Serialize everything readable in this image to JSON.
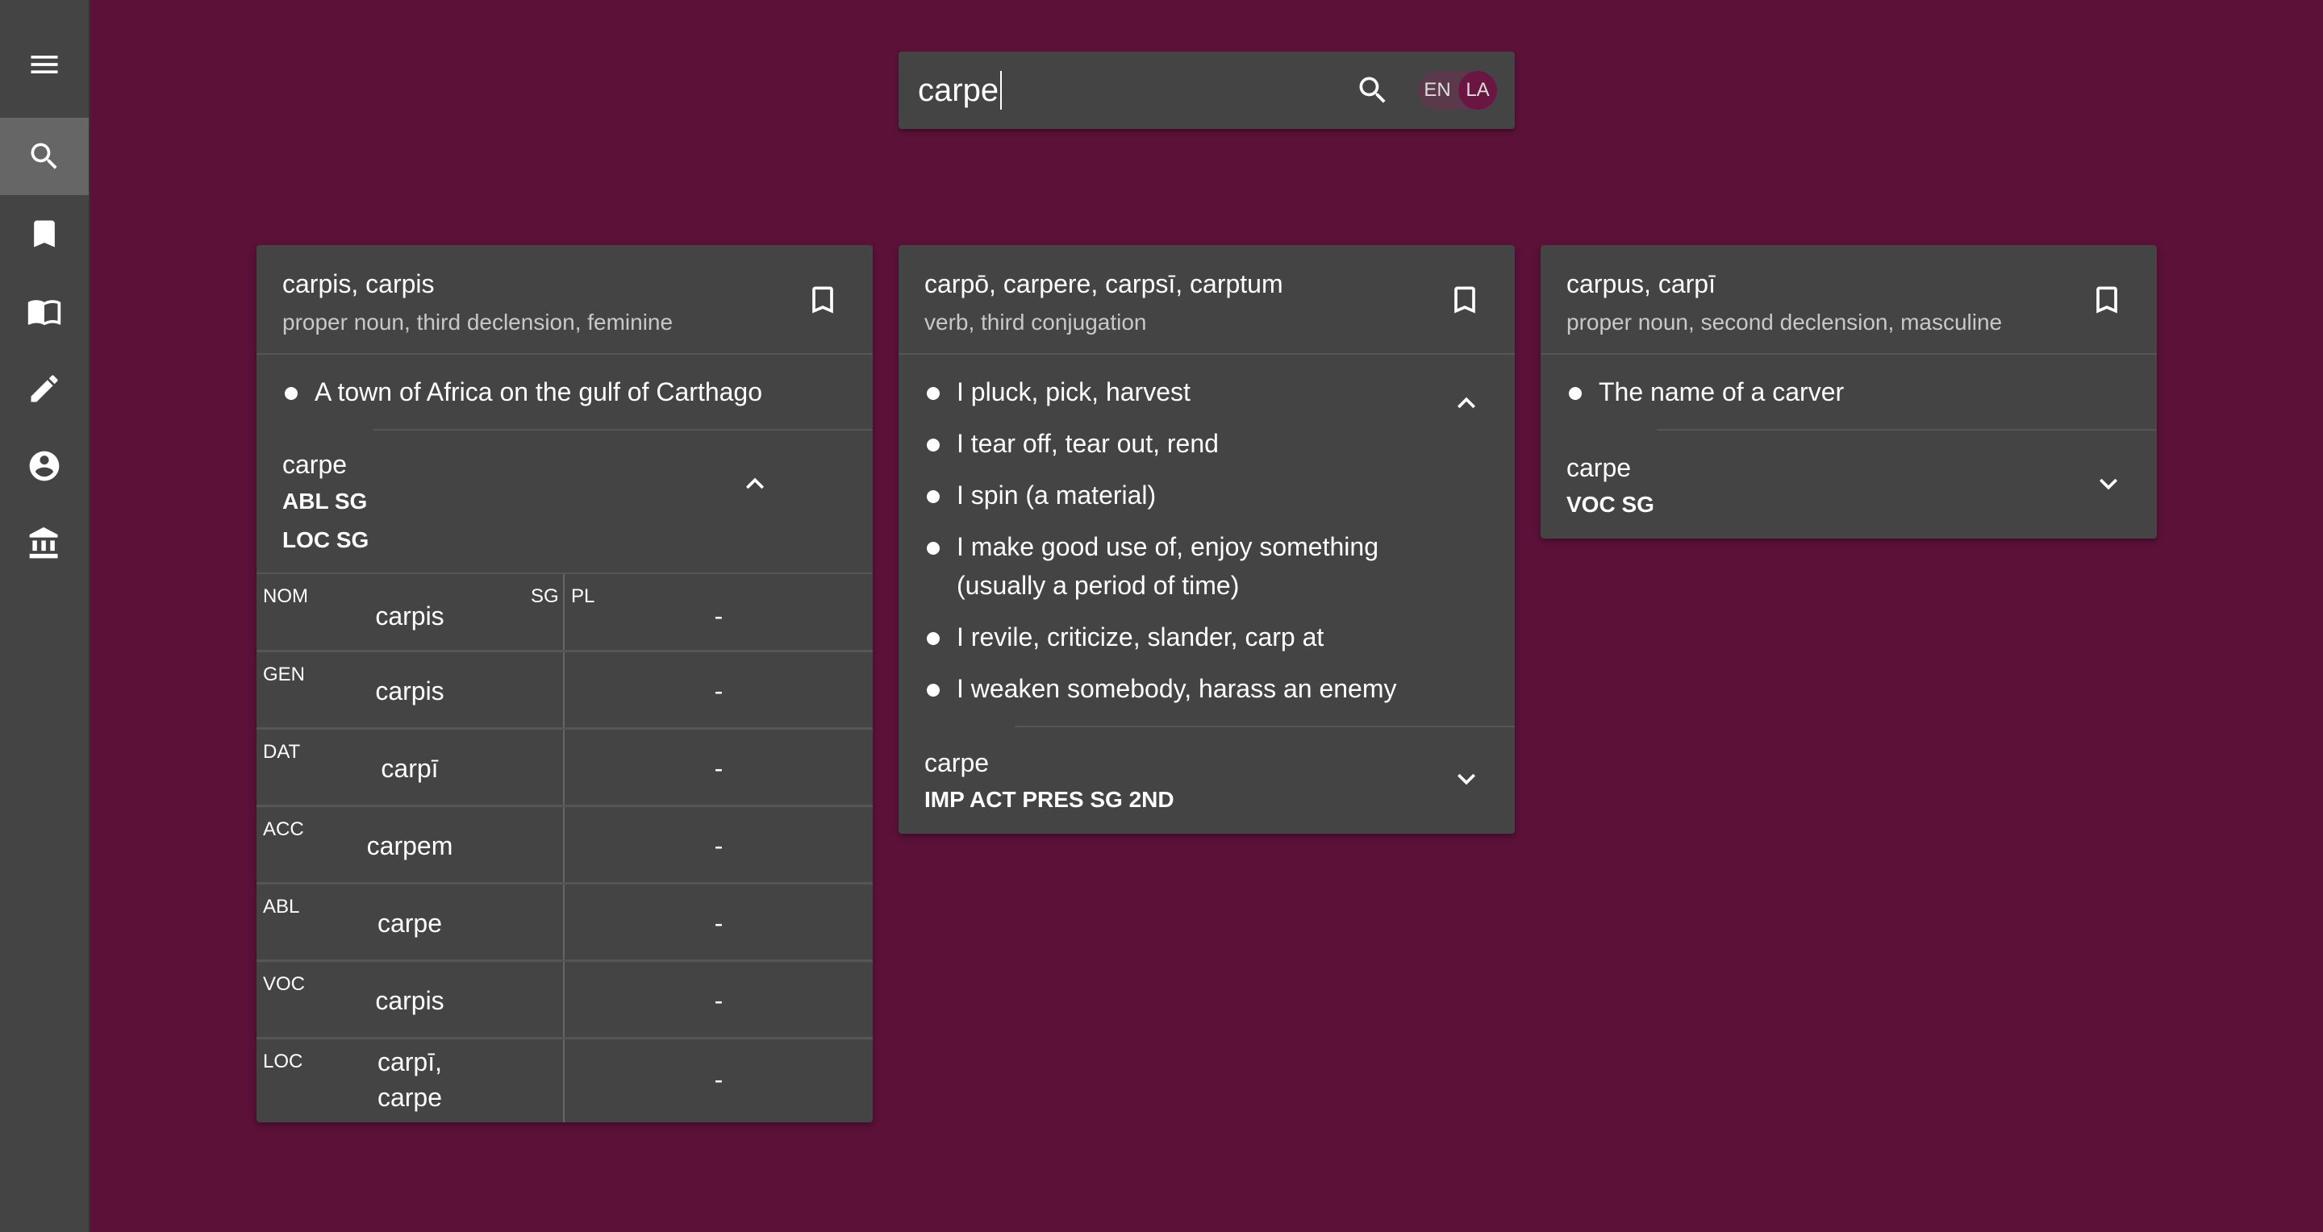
{
  "sidebar": {
    "items": [
      {
        "icon": "menu-icon"
      },
      {
        "icon": "search-icon",
        "active": true
      },
      {
        "icon": "bookmark-icon"
      },
      {
        "icon": "book-open-icon"
      },
      {
        "icon": "pencil-icon"
      },
      {
        "icon": "account-icon"
      },
      {
        "icon": "institution-icon"
      }
    ]
  },
  "search": {
    "value": "carpe",
    "lang_en": "EN",
    "lang_la": "LA",
    "selected_lang": "LA"
  },
  "cards": [
    {
      "headword": "carpis, carpis",
      "pos": "proper noun, third declension, feminine",
      "definitions": [
        "A town of Africa on the gulf of Carthago"
      ],
      "form": {
        "word": "carpe",
        "tags": [
          "ABL SG",
          "LOC SG"
        ],
        "expanded": true
      },
      "table": {
        "col_sg": "SG",
        "col_pl": "PL",
        "rows": [
          {
            "case": "NOM",
            "sg": "carpis",
            "pl": "-"
          },
          {
            "case": "GEN",
            "sg": "carpis",
            "pl": "-"
          },
          {
            "case": "DAT",
            "sg": "carpī",
            "pl": "-"
          },
          {
            "case": "ACC",
            "sg": "carpem",
            "pl": "-"
          },
          {
            "case": "ABL",
            "sg": "carpe",
            "pl": "-"
          },
          {
            "case": "VOC",
            "sg": "carpis",
            "pl": "-"
          },
          {
            "case": "LOC",
            "sg": "carpī,\ncarpe",
            "pl": "-"
          }
        ]
      }
    },
    {
      "headword": "carpō, carpere, carpsī, carptum",
      "pos": "verb, third conjugation",
      "definitions": [
        "I pluck, pick, harvest",
        "I tear off, tear out, rend",
        "I spin (a material)",
        "I make good use of, enjoy something (usually a period of time)",
        "I revile, criticize, slander, carp at",
        "I weaken somebody, harass an enemy"
      ],
      "form": {
        "word": "carpe",
        "tags": [
          "IMP ACT PRES SG 2ND"
        ],
        "expanded": false
      }
    },
    {
      "headword": "carpus, carpī",
      "pos": "proper noun, second declension, masculine",
      "definitions": [
        "The name of a carver"
      ],
      "form": {
        "word": "carpe",
        "tags": [
          "VOC SG"
        ],
        "expanded": false
      }
    }
  ],
  "colors": {
    "background": "#5c1139",
    "panel": "#444444",
    "sidebar": "#444444",
    "accent": "#6b1642"
  }
}
